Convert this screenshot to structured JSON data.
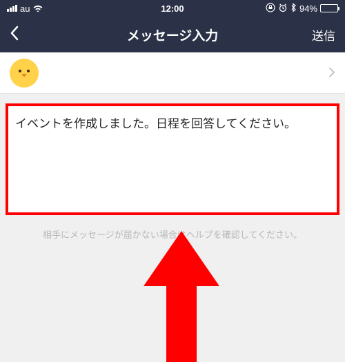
{
  "status": {
    "carrier": "au",
    "time": "12:00",
    "battery_pct": "94%"
  },
  "nav": {
    "title": "メッセージ入力",
    "send": "送信"
  },
  "message": {
    "text": "イベントを作成しました。日程を回答してください。"
  },
  "help": {
    "text": "相手にメッセージが届かない場合はヘルプを確認してください。"
  }
}
